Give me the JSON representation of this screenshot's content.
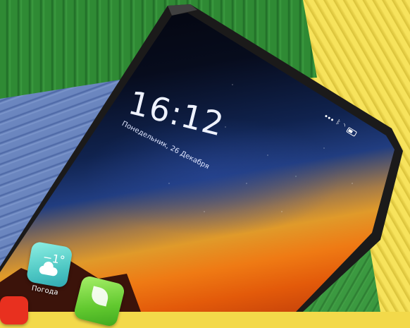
{
  "lockscreen": {
    "time": "16:12",
    "date": "Понедельник, 26 Декабря"
  },
  "status_bar": {
    "icons": [
      "dots-icon",
      "bluetooth-icon",
      "wifi-icon",
      "battery-icon"
    ]
  },
  "apps": {
    "weather": {
      "temperature": "−1°",
      "label": "Погода",
      "icon": "cloud-icon"
    },
    "second_app": {
      "icon": "leaf-icon"
    },
    "third_app": {
      "icon": "app-icon"
    }
  },
  "colors": {
    "sky_top": "#03040a",
    "sky_mid": "#213d80",
    "horizon": "#ef7a14",
    "weather_tile": "#4fc8c4",
    "green_tile": "#62c92f",
    "red_tile": "#e8301f"
  }
}
